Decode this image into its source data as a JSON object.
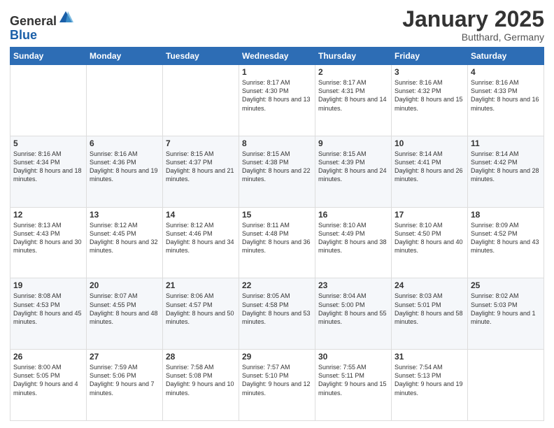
{
  "header": {
    "logo_line1": "General",
    "logo_line2": "Blue",
    "month": "January 2025",
    "location": "Butthard, Germany"
  },
  "weekdays": [
    "Sunday",
    "Monday",
    "Tuesday",
    "Wednesday",
    "Thursday",
    "Friday",
    "Saturday"
  ],
  "weeks": [
    [
      {
        "day": "",
        "info": ""
      },
      {
        "day": "",
        "info": ""
      },
      {
        "day": "",
        "info": ""
      },
      {
        "day": "1",
        "info": "Sunrise: 8:17 AM\nSunset: 4:30 PM\nDaylight: 8 hours\nand 13 minutes."
      },
      {
        "day": "2",
        "info": "Sunrise: 8:17 AM\nSunset: 4:31 PM\nDaylight: 8 hours\nand 14 minutes."
      },
      {
        "day": "3",
        "info": "Sunrise: 8:16 AM\nSunset: 4:32 PM\nDaylight: 8 hours\nand 15 minutes."
      },
      {
        "day": "4",
        "info": "Sunrise: 8:16 AM\nSunset: 4:33 PM\nDaylight: 8 hours\nand 16 minutes."
      }
    ],
    [
      {
        "day": "5",
        "info": "Sunrise: 8:16 AM\nSunset: 4:34 PM\nDaylight: 8 hours\nand 18 minutes."
      },
      {
        "day": "6",
        "info": "Sunrise: 8:16 AM\nSunset: 4:36 PM\nDaylight: 8 hours\nand 19 minutes."
      },
      {
        "day": "7",
        "info": "Sunrise: 8:15 AM\nSunset: 4:37 PM\nDaylight: 8 hours\nand 21 minutes."
      },
      {
        "day": "8",
        "info": "Sunrise: 8:15 AM\nSunset: 4:38 PM\nDaylight: 8 hours\nand 22 minutes."
      },
      {
        "day": "9",
        "info": "Sunrise: 8:15 AM\nSunset: 4:39 PM\nDaylight: 8 hours\nand 24 minutes."
      },
      {
        "day": "10",
        "info": "Sunrise: 8:14 AM\nSunset: 4:41 PM\nDaylight: 8 hours\nand 26 minutes."
      },
      {
        "day": "11",
        "info": "Sunrise: 8:14 AM\nSunset: 4:42 PM\nDaylight: 8 hours\nand 28 minutes."
      }
    ],
    [
      {
        "day": "12",
        "info": "Sunrise: 8:13 AM\nSunset: 4:43 PM\nDaylight: 8 hours\nand 30 minutes."
      },
      {
        "day": "13",
        "info": "Sunrise: 8:12 AM\nSunset: 4:45 PM\nDaylight: 8 hours\nand 32 minutes."
      },
      {
        "day": "14",
        "info": "Sunrise: 8:12 AM\nSunset: 4:46 PM\nDaylight: 8 hours\nand 34 minutes."
      },
      {
        "day": "15",
        "info": "Sunrise: 8:11 AM\nSunset: 4:48 PM\nDaylight: 8 hours\nand 36 minutes."
      },
      {
        "day": "16",
        "info": "Sunrise: 8:10 AM\nSunset: 4:49 PM\nDaylight: 8 hours\nand 38 minutes."
      },
      {
        "day": "17",
        "info": "Sunrise: 8:10 AM\nSunset: 4:50 PM\nDaylight: 8 hours\nand 40 minutes."
      },
      {
        "day": "18",
        "info": "Sunrise: 8:09 AM\nSunset: 4:52 PM\nDaylight: 8 hours\nand 43 minutes."
      }
    ],
    [
      {
        "day": "19",
        "info": "Sunrise: 8:08 AM\nSunset: 4:53 PM\nDaylight: 8 hours\nand 45 minutes."
      },
      {
        "day": "20",
        "info": "Sunrise: 8:07 AM\nSunset: 4:55 PM\nDaylight: 8 hours\nand 48 minutes."
      },
      {
        "day": "21",
        "info": "Sunrise: 8:06 AM\nSunset: 4:57 PM\nDaylight: 8 hours\nand 50 minutes."
      },
      {
        "day": "22",
        "info": "Sunrise: 8:05 AM\nSunset: 4:58 PM\nDaylight: 8 hours\nand 53 minutes."
      },
      {
        "day": "23",
        "info": "Sunrise: 8:04 AM\nSunset: 5:00 PM\nDaylight: 8 hours\nand 55 minutes."
      },
      {
        "day": "24",
        "info": "Sunrise: 8:03 AM\nSunset: 5:01 PM\nDaylight: 8 hours\nand 58 minutes."
      },
      {
        "day": "25",
        "info": "Sunrise: 8:02 AM\nSunset: 5:03 PM\nDaylight: 9 hours\nand 1 minute."
      }
    ],
    [
      {
        "day": "26",
        "info": "Sunrise: 8:00 AM\nSunset: 5:05 PM\nDaylight: 9 hours\nand 4 minutes."
      },
      {
        "day": "27",
        "info": "Sunrise: 7:59 AM\nSunset: 5:06 PM\nDaylight: 9 hours\nand 7 minutes."
      },
      {
        "day": "28",
        "info": "Sunrise: 7:58 AM\nSunset: 5:08 PM\nDaylight: 9 hours\nand 10 minutes."
      },
      {
        "day": "29",
        "info": "Sunrise: 7:57 AM\nSunset: 5:10 PM\nDaylight: 9 hours\nand 12 minutes."
      },
      {
        "day": "30",
        "info": "Sunrise: 7:55 AM\nSunset: 5:11 PM\nDaylight: 9 hours\nand 15 minutes."
      },
      {
        "day": "31",
        "info": "Sunrise: 7:54 AM\nSunset: 5:13 PM\nDaylight: 9 hours\nand 19 minutes."
      },
      {
        "day": "",
        "info": ""
      }
    ]
  ]
}
